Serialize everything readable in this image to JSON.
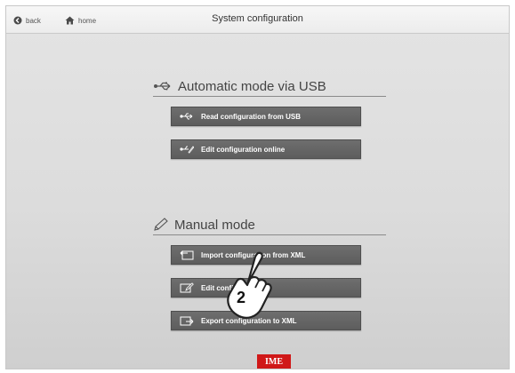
{
  "topbar": {
    "back_label": "back",
    "home_label": "home",
    "title": "System configuration"
  },
  "usb_section": {
    "heading": "Automatic mode via USB",
    "buttons": [
      {
        "label": "Read configuration from USB",
        "icon": "usb-icon"
      },
      {
        "label": "Edit configuration online",
        "icon": "usb-edit-icon"
      }
    ]
  },
  "manual_section": {
    "heading": "Manual mode",
    "buttons": [
      {
        "label": "Import configuration from XML",
        "icon": "import-icon"
      },
      {
        "label": "Edit configuration",
        "icon": "edit-icon"
      },
      {
        "label": "Export configuration to XML",
        "icon": "export-icon"
      }
    ]
  },
  "callout": {
    "step_number": "2",
    "icon": "pointing-hand-icon"
  },
  "footer": {
    "logo_text": "IME",
    "logo_color": "#d01818"
  }
}
